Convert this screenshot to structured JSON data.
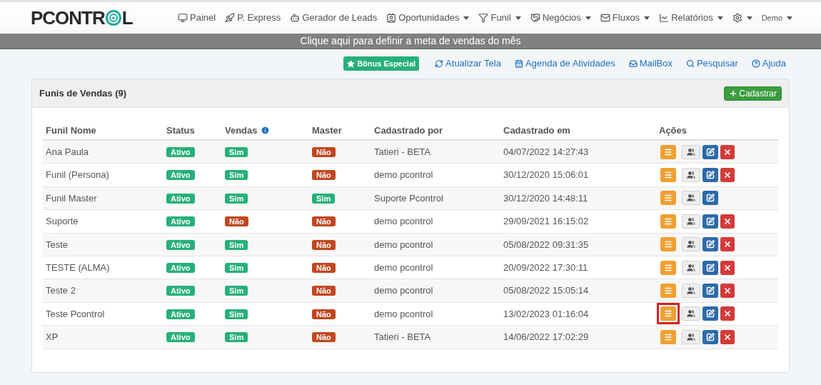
{
  "logo": {
    "before": "PCONTR",
    "after": "L"
  },
  "nav": [
    {
      "kind": "link",
      "label": "Painel",
      "dropdown": false
    },
    {
      "kind": "link",
      "label": "P. Express",
      "dropdown": false
    },
    {
      "kind": "link",
      "label": "Gerador de Leads",
      "dropdown": false
    },
    {
      "kind": "link",
      "label": "Oportunidades",
      "dropdown": true
    },
    {
      "kind": "link",
      "label": "Funil",
      "dropdown": true
    },
    {
      "kind": "link",
      "label": "Negócios",
      "dropdown": true
    },
    {
      "kind": "link",
      "label": "Fluxos",
      "dropdown": true
    },
    {
      "kind": "link",
      "label": "Relatórios",
      "dropdown": true
    },
    {
      "kind": "settings",
      "dropdown": true
    },
    {
      "kind": "user",
      "label": "Demo",
      "dropdown": true
    }
  ],
  "banner": "Clique aqui para definir a meta de vendas do mês",
  "bonus": "Bônus Especial",
  "links": [
    "Atualizar Tela",
    "Agenda de Atividades",
    "MailBox",
    "Pesquisar",
    "Ajuda"
  ],
  "panel": {
    "title": "Funis de Vendas (9)",
    "add_button": "Cadastrar"
  },
  "columns": [
    "Funil Nome",
    "Status",
    "Vendas",
    "Master",
    "Cadastrado por",
    "Cadastrado em",
    "Ações"
  ],
  "rows": [
    {
      "name": "Ana Paula",
      "status": "Ativo",
      "vendas": {
        "text": "Sim",
        "on": true
      },
      "master": {
        "text": "Não",
        "on": false
      },
      "by": "Tatieri - BETA",
      "at": "04/07/2022 14:27:43",
      "deletable": true,
      "highlighted": false
    },
    {
      "name": "Funil (Persona)",
      "status": "Ativo",
      "vendas": {
        "text": "Sim",
        "on": true
      },
      "master": {
        "text": "Não",
        "on": false
      },
      "by": "demo pcontrol",
      "at": "30/12/2020 15:06:01",
      "deletable": true,
      "highlighted": false
    },
    {
      "name": "Funil Master",
      "status": "Ativo",
      "vendas": {
        "text": "Sim",
        "on": true
      },
      "master": {
        "text": "Sim",
        "on": true
      },
      "by": "Suporte Pcontrol",
      "at": "30/12/2020 14:48:11",
      "deletable": false,
      "highlighted": false
    },
    {
      "name": "Suporte",
      "status": "Ativo",
      "vendas": {
        "text": "Não",
        "on": false
      },
      "master": {
        "text": "Não",
        "on": false
      },
      "by": "demo pcontrol",
      "at": "29/09/2021 16:15:02",
      "deletable": true,
      "highlighted": false
    },
    {
      "name": "Teste",
      "status": "Ativo",
      "vendas": {
        "text": "Sim",
        "on": true
      },
      "master": {
        "text": "Não",
        "on": false
      },
      "by": "demo pcontrol",
      "at": "05/08/2022 09:31:35",
      "deletable": true,
      "highlighted": false
    },
    {
      "name": "TESTE (ALMA)",
      "status": "Ativo",
      "vendas": {
        "text": "Sim",
        "on": true
      },
      "master": {
        "text": "Não",
        "on": false
      },
      "by": "demo pcontrol",
      "at": "20/09/2022 17:30:11",
      "deletable": true,
      "highlighted": false
    },
    {
      "name": "Teste 2",
      "status": "Ativo",
      "vendas": {
        "text": "Sim",
        "on": true
      },
      "master": {
        "text": "Não",
        "on": false
      },
      "by": "demo pcontrol",
      "at": "05/08/2022 15:05:14",
      "deletable": true,
      "highlighted": false
    },
    {
      "name": "Teste Pcontrol",
      "status": "Ativo",
      "vendas": {
        "text": "Sim",
        "on": true
      },
      "master": {
        "text": "Não",
        "on": false
      },
      "by": "demo pcontrol",
      "at": "13/02/2023 01:16:04",
      "deletable": true,
      "highlighted": true
    },
    {
      "name": "XP",
      "status": "Ativo",
      "vendas": {
        "text": "Sim",
        "on": true
      },
      "master": {
        "text": "Não",
        "on": false
      },
      "by": "Tatieri - BETA",
      "at": "14/06/2022 17:02:29",
      "deletable": true,
      "highlighted": false
    }
  ]
}
